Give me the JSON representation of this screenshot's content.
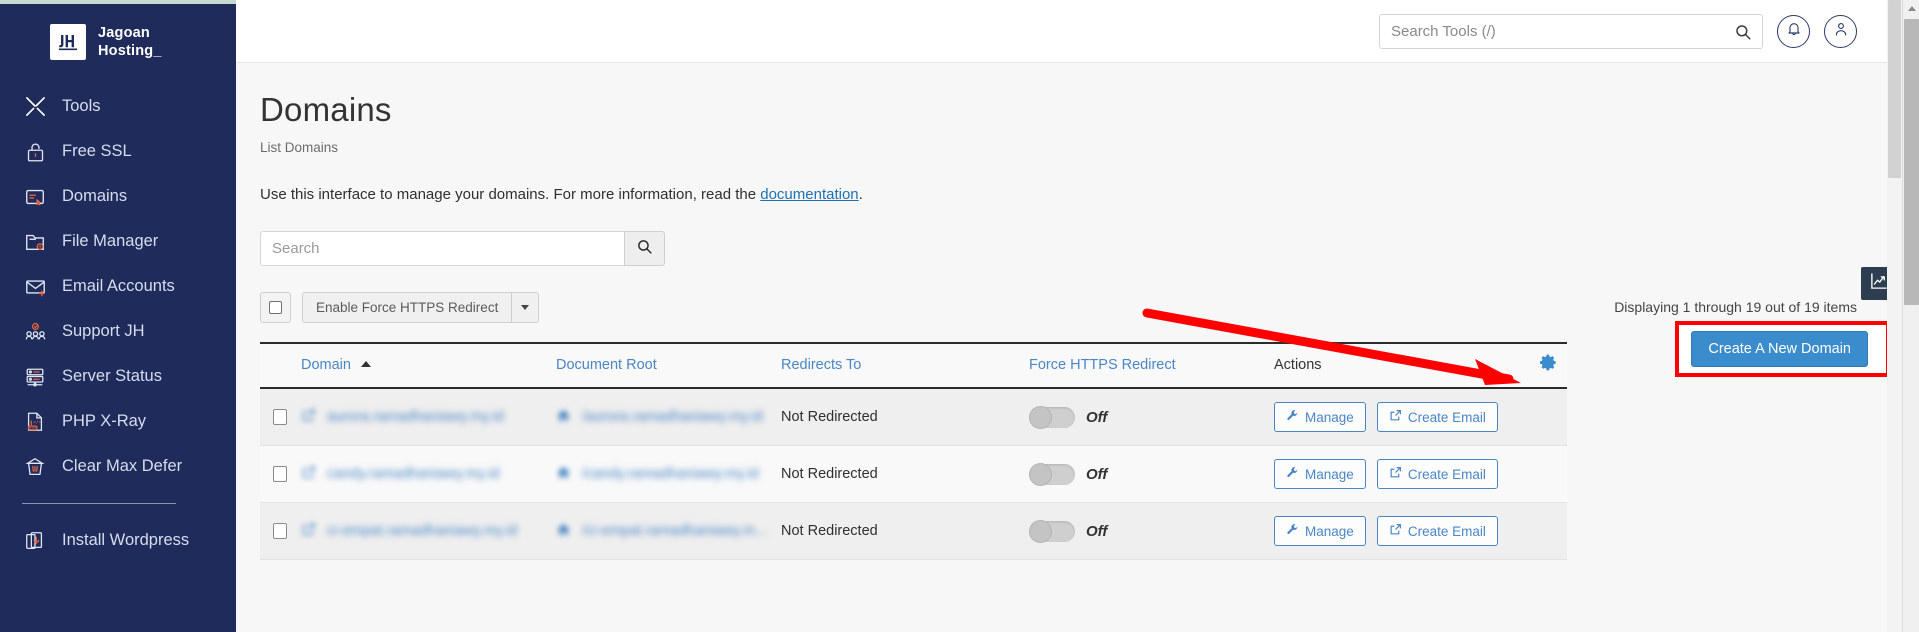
{
  "sidebar": {
    "brand": {
      "mark": "JH",
      "line1": "Jagoan",
      "line2": "Hosting_"
    },
    "items": [
      {
        "label": "Tools",
        "icon": "tools-icon"
      },
      {
        "label": "Free SSL",
        "icon": "lock-icon"
      },
      {
        "label": "Domains",
        "icon": "domains-icon"
      },
      {
        "label": "File Manager",
        "icon": "folder-gear-icon"
      },
      {
        "label": "Email Accounts",
        "icon": "envelope-plus-icon"
      },
      {
        "label": "Support JH",
        "icon": "people-icon"
      },
      {
        "label": "Server Status",
        "icon": "server-icon"
      },
      {
        "label": "PHP X-Ray",
        "icon": "php-file-icon"
      },
      {
        "label": "Clear Max Defer",
        "icon": "trash-icon"
      }
    ],
    "items_after_divider": [
      {
        "label": "Install Wordpress",
        "icon": "wordpress-install-icon"
      }
    ]
  },
  "topbar": {
    "search_placeholder": "Search Tools (/)",
    "search_value": "",
    "search_icon": "search-icon",
    "notification_icon": "bell-icon",
    "account_icon": "user-icon"
  },
  "page": {
    "title": "Domains",
    "breadcrumb": "List Domains",
    "intro_before": "Use this interface to manage your domains. For more information, read the ",
    "intro_link": "documentation",
    "intro_after": "."
  },
  "filter": {
    "search_placeholder": "Search",
    "search_value": "",
    "search_button_icon": "search-icon",
    "displaying": "Displaying 1 through 19 out of 19 items",
    "create_button": "Create A New Domain",
    "stats_icon": "chart-line-icon",
    "highlight_color": "#ff0000",
    "accent_color": "#3b8ccd"
  },
  "bulk": {
    "select_all_checked": false,
    "action_label": "Enable Force HTTPS Redirect",
    "caret_icon": "chevron-down-icon"
  },
  "table": {
    "columns": [
      {
        "label": "Domain",
        "sortable": true,
        "sorted": "asc"
      },
      {
        "label": "Document Root",
        "sortable": true
      },
      {
        "label": "Redirects To",
        "sortable": true
      },
      {
        "label": "Force HTTPS Redirect",
        "sortable": true
      },
      {
        "label": "Actions",
        "sortable": false
      }
    ],
    "settings_icon": "gear-icon",
    "rows": [
      {
        "domain": "aurora.ramadhaniawy.my.id",
        "domain_icon": "external-link-icon",
        "document_root": "/aurora.ramadhaniawy.my.id",
        "docroot_icon": "home-icon",
        "redirects_to": "Not Redirected",
        "force_https": "Off",
        "force_https_on": false,
        "actions": [
          {
            "label": "Manage",
            "icon": "wrench-icon"
          },
          {
            "label": "Create Email",
            "icon": "external-link-icon"
          }
        ]
      },
      {
        "domain": "candy.ramadhaniawy.my.id",
        "domain_icon": "external-link-icon",
        "document_root": "/candy.ramadhaniawy.my.id",
        "docroot_icon": "home-icon",
        "redirects_to": "Not Redirected",
        "force_https": "Off",
        "force_https_on": false,
        "actions": [
          {
            "label": "Manage",
            "icon": "wrench-icon"
          },
          {
            "label": "Create Email",
            "icon": "external-link-icon"
          }
        ]
      },
      {
        "domain": "ci-empat.ramadhaniawy.my.id",
        "domain_icon": "external-link-icon",
        "document_root": "/ci-empat.ramadhaniawy.m...",
        "docroot_icon": "home-icon",
        "redirects_to": "Not Redirected",
        "force_https": "Off",
        "force_https_on": false,
        "actions": [
          {
            "label": "Manage",
            "icon": "wrench-icon"
          },
          {
            "label": "Create Email",
            "icon": "external-link-icon"
          }
        ]
      }
    ]
  }
}
